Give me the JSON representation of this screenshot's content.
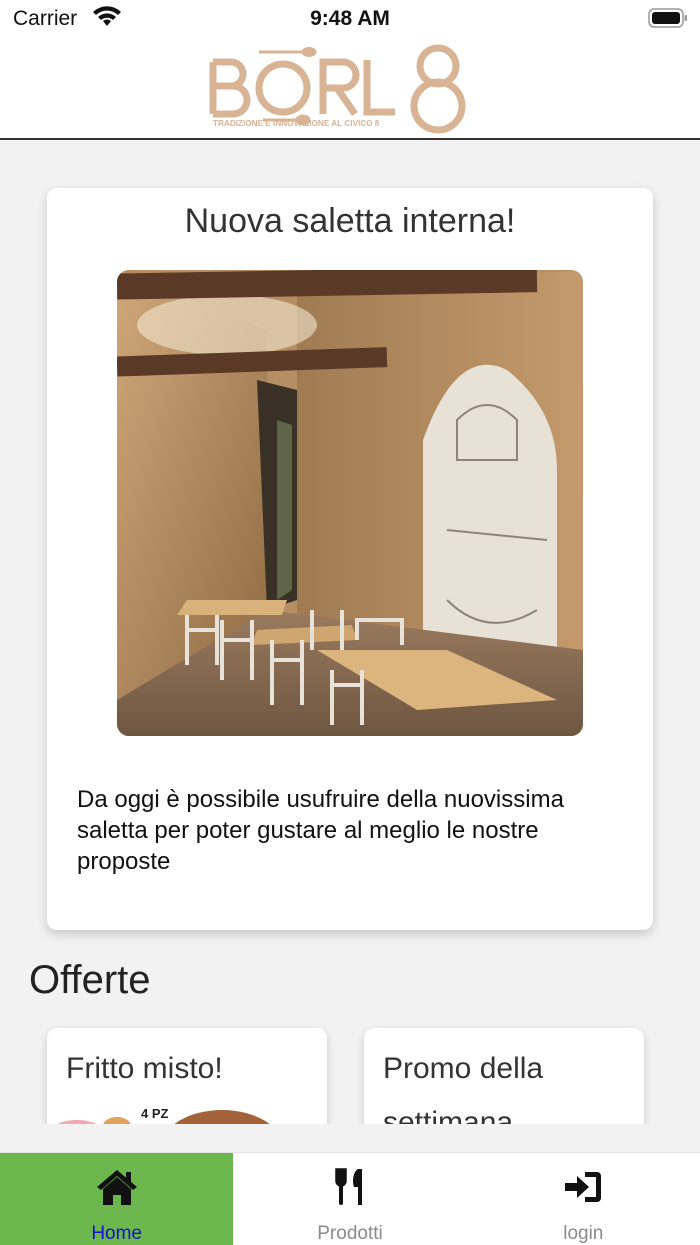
{
  "status_bar": {
    "carrier": "Carrier",
    "time": "9:48 AM"
  },
  "header": {
    "logo_wordmark": "BORL8",
    "logo_tagline": "TRADIZIONE E INNOVAZIONE AL CIVICO 8",
    "logo_color": "#d8b394"
  },
  "news": {
    "title": "Nuova saletta interna!",
    "body": "Da oggi è possibile usufruire della nuovissima saletta per poter gustare al meglio le nostre proposte"
  },
  "offers": {
    "heading": "Offerte",
    "items": [
      {
        "title": "Fritto misto!",
        "badge": "4 PZ"
      },
      {
        "title": "Promo della settimana"
      }
    ]
  },
  "tab_bar": {
    "active_color": "#6cb84f",
    "active_label_color": "#1212cc",
    "items": [
      {
        "label": "Home",
        "icon": "home-icon",
        "active": true
      },
      {
        "label": "Prodotti",
        "icon": "utensils-icon",
        "active": false
      },
      {
        "label": "login",
        "icon": "sign-in-icon",
        "active": false
      }
    ]
  }
}
